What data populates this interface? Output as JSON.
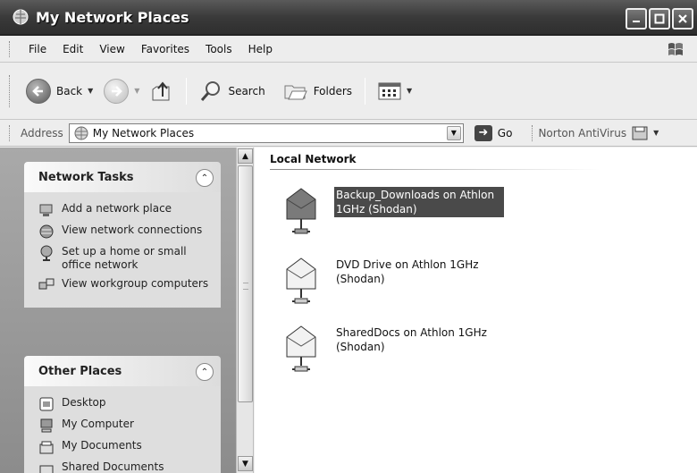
{
  "window": {
    "title": "My Network Places"
  },
  "menu": [
    "File",
    "Edit",
    "View",
    "Favorites",
    "Tools",
    "Help"
  ],
  "toolbar": {
    "back": "Back",
    "search": "Search",
    "folders": "Folders"
  },
  "address": {
    "label": "Address",
    "value": "My Network Places",
    "go": "Go",
    "norton": "Norton AntiVirus"
  },
  "network_tasks": {
    "title": "Network Tasks",
    "items": [
      {
        "label": "Add a network place",
        "icon": "add-network-place-icon"
      },
      {
        "label": "View network connections",
        "icon": "network-connections-icon"
      },
      {
        "label": "Set up a home or small office network",
        "icon": "home-network-setup-icon"
      },
      {
        "label": "View workgroup computers",
        "icon": "workgroup-computers-icon"
      }
    ]
  },
  "other_places": {
    "title": "Other Places",
    "items": [
      {
        "label": "Desktop",
        "icon": "desktop-icon"
      },
      {
        "label": "My Computer",
        "icon": "my-computer-icon"
      },
      {
        "label": "My Documents",
        "icon": "my-documents-icon"
      },
      {
        "label": "Shared Documents",
        "icon": "shared-documents-icon"
      }
    ]
  },
  "main": {
    "group_title": "Local Network",
    "shares": [
      {
        "line1": "Backup_Downloads on Athlon",
        "line2": "1GHz (Shodan)",
        "selected": true
      },
      {
        "line1": "DVD Drive on Athlon 1GHz",
        "line2": "(Shodan)",
        "selected": false
      },
      {
        "line1": "SharedDocs on Athlon 1GHz",
        "line2": "(Shodan)",
        "selected": false
      }
    ]
  },
  "colors": {
    "titlebar": "#3a3a3a",
    "selection": "#4a4a4a",
    "panel_bg": "#dedede"
  }
}
